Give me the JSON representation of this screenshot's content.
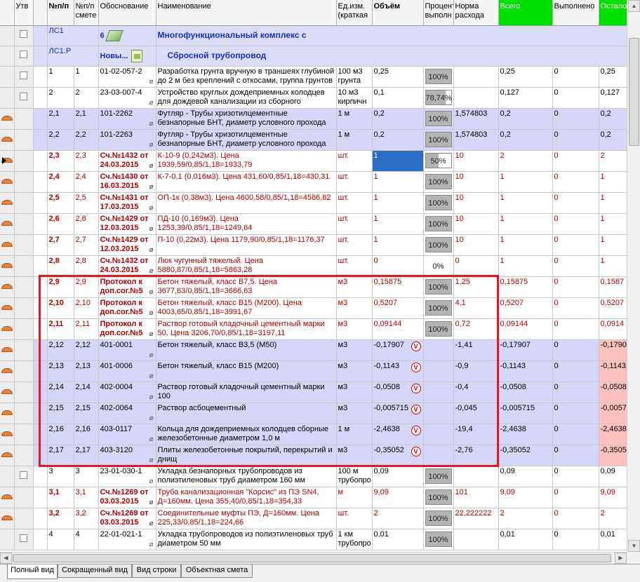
{
  "columns": {
    "utv": "Утв",
    "npp": "№п/п",
    "npp_smeta": "№п/п смете",
    "basis": "Обоснование",
    "name": "Наименование",
    "unit": "Ед.изм. (краткая",
    "volume": "Объём",
    "percent": "Процент выполн",
    "norm": "Норма расхода",
    "total": "Всего",
    "done": "Выполнено",
    "remain": "Остало"
  },
  "sections": [
    {
      "code": "ЛС1",
      "num": "6",
      "title": "Многофункциональный комплекс с"
    },
    {
      "code": "ЛС1.Р",
      "num": "Новы...",
      "title": "Сбросной трубопровод"
    }
  ],
  "rows": [
    {
      "npp": "1",
      "smeta": "1",
      "basis": "01-02-057-2",
      "name": "Разработка грунта вручную в траншеях глубиной до 2 м без креплений с откосами, группа грунтов",
      "unit": "100 м3 грунта",
      "volume": "0,25",
      "pct": "100%",
      "norm": "",
      "total": "0,25",
      "done": "0",
      "remain": "0,25"
    },
    {
      "npp": "2",
      "smeta": "2",
      "basis": "23-03-007-4",
      "name": "Устройство круглых дождеприемных колодцев для дождевой канализации из сборного",
      "unit": "10 м3 кирпичн",
      "volume": "0,1",
      "pct": "78,74%",
      "norm": "",
      "total": "0,127",
      "done": "0",
      "remain": "0,127"
    },
    {
      "npp": "2,1",
      "smeta": "2,1",
      "basis": "101-2262",
      "name": "Футляр - Трубы хризотилцементные безнапорные БНТ, диаметр условного прохода",
      "unit": "1 м",
      "volume": "0,2",
      "pct": "100%",
      "norm": "1,574803",
      "total": "0,2",
      "done": "0",
      "remain": "0,2"
    },
    {
      "npp": "2,2",
      "smeta": "2,2",
      "basis": "101-2263",
      "name": "Футляр - Трубы хризотилцементные безнапорные БНТ, диаметр условного прохода",
      "unit": "1 м",
      "volume": "0,2",
      "pct": "100%",
      "norm": "1,574803",
      "total": "0,2",
      "done": "0",
      "remain": "0,2"
    },
    {
      "npp": "2,3",
      "smeta": "2,3",
      "basis": "Сч.№1432 от 24.03.2015",
      "name": "К-10-9 (0,242м3). Цена 1939,59/0,85/1,18=1933,79",
      "unit": "шт.",
      "volume": "1",
      "pct": "50%",
      "norm": "10",
      "total": "2",
      "done": "0",
      "remain": "2"
    },
    {
      "npp": "2,4",
      "smeta": "2,4",
      "basis": "Сч.№1430 от 16.03.2015",
      "name": "К-7-0,1 (0,016м3). Цена 431,60/0,85/1,18=430,31",
      "unit": "шт.",
      "volume": "1",
      "pct": "100%",
      "norm": "10",
      "total": "1",
      "done": "0",
      "remain": "1"
    },
    {
      "npp": "2,5",
      "smeta": "2,5",
      "basis": "Сч.№1431 от 17.03.2015",
      "name": "ОП-1к (0,38м3). Цена 4600,58/0,85/1,18=4586,82",
      "unit": "шт.",
      "volume": "1",
      "pct": "100%",
      "norm": "10",
      "total": "1",
      "done": "0",
      "remain": "1"
    },
    {
      "npp": "2,6",
      "smeta": "2,6",
      "basis": "Сч.№1429 от 12.03.2015",
      "name": "ПД-10 (0,169м3). Цена 1253,39/0,85/1,18=1249,64",
      "unit": "шт.",
      "volume": "1",
      "pct": "100%",
      "norm": "10",
      "total": "1",
      "done": "0",
      "remain": "1"
    },
    {
      "npp": "2,7",
      "smeta": "2,7",
      "basis": "Сч.№1429 от 12.03.2015",
      "name": "П-10 (0,22м3). Цена 1179,90/0,85/1,18=1176,37",
      "unit": "шт.",
      "volume": "1",
      "pct": "100%",
      "norm": "10",
      "total": "1",
      "done": "0",
      "remain": "1"
    },
    {
      "npp": "2,8",
      "smeta": "2,8",
      "basis": "Сч.№1432 от 24.03.2015",
      "name": "Люк чугунный тяжелый. Цена 5880,87/0,85/1,18=5863,28",
      "unit": "шт.",
      "volume": "0",
      "pct": "0%",
      "norm": "0",
      "total": "1",
      "done": "0",
      "remain": "1"
    },
    {
      "npp": "2,9",
      "smeta": "2,9",
      "basis": "Протокол к доп.сог.№5",
      "name": "Бетон тяжелый, класс В7,5. Цена 3677,63/0,85/1,18=3666,63",
      "unit": "м3",
      "volume": "0,15875",
      "pct": "100%",
      "norm": "1,25",
      "total": "0,15875",
      "done": "0",
      "remain": "0,1587"
    },
    {
      "npp": "2,10",
      "smeta": "2,10",
      "basis": "Протокол к доп.сог.№5",
      "name": "Бетон тяжелый, класс В15 (М200). Цена 4003,65/0,85/1,18=3991,67",
      "unit": "м3",
      "volume": "0,5207",
      "pct": "100%",
      "norm": "4,1",
      "total": "0,5207",
      "done": "0",
      "remain": "0,5207"
    },
    {
      "npp": "2,11",
      "smeta": "2,11",
      "basis": "Протокол к доп.сог.№5",
      "name": "Раствор готовый кладочный цементный марки 50. Цена 3206,70/0,85/1,18=3197,11",
      "unit": "м3",
      "volume": "0,09144",
      "pct": "100%",
      "norm": "0,72",
      "total": "0,09144",
      "done": "0",
      "remain": "0,0914"
    },
    {
      "npp": "2,12",
      "smeta": "2,12",
      "basis": "401-0001",
      "name": "Бетон тяжелый, класс В3,5 (М50)",
      "unit": "м3",
      "volume": "-0,17907",
      "pct": "",
      "norm": "-1,41",
      "total": "-0,17907",
      "done": "0",
      "remain": "-0,1790"
    },
    {
      "npp": "2,13",
      "smeta": "2,13",
      "basis": "401-0006",
      "name": "Бетон тяжелый, класс В15 (М200)",
      "unit": "м3",
      "volume": "-0,1143",
      "pct": "",
      "norm": "-0,9",
      "total": "-0,1143",
      "done": "0",
      "remain": "-0,1143"
    },
    {
      "npp": "2,14",
      "smeta": "2,14",
      "basis": "402-0004",
      "name": "Раствор готовый кладочный цементный марки 100",
      "unit": "м3",
      "volume": "-0,0508",
      "pct": "",
      "norm": "-0,4",
      "total": "-0,0508",
      "done": "0",
      "remain": "-0,0508"
    },
    {
      "npp": "2,15",
      "smeta": "2,15",
      "basis": "402-0064",
      "name": "Раствор асбоцементный",
      "unit": "м3",
      "volume": "-0,005715",
      "pct": "",
      "norm": "-0,045",
      "total": "-0,005715",
      "done": "0",
      "remain": "-0,0057"
    },
    {
      "npp": "2,16",
      "smeta": "2,16",
      "basis": "403-0117",
      "name": "Кольца для дождеприемных колодцев сборные железобетонные диаметром 1,0 м",
      "unit": "1 м",
      "volume": "-2,4638",
      "pct": "",
      "norm": "-19,4",
      "total": "-2,4638",
      "done": "0",
      "remain": "-2,4638"
    },
    {
      "npp": "2,17",
      "smeta": "2,17",
      "basis": "403-3120",
      "name": "Плиты железобетонные покрытий, перекрытий и днищ",
      "unit": "м3",
      "volume": "-0,35052",
      "pct": "",
      "norm": "-2,76",
      "total": "-0,35052",
      "done": "0",
      "remain": "-0,3505"
    },
    {
      "npp": "3",
      "smeta": "3",
      "basis": "23-01-030-1",
      "name": "Укладка безнапорных трубопроводов из полиэтиленовых труб диаметром 160 мм",
      "unit": "100 м трубопро",
      "volume": "0,09",
      "pct": "100%",
      "norm": "",
      "total": "0,09",
      "done": "0",
      "remain": "0,09"
    },
    {
      "npp": "3,1",
      "smeta": "3,1",
      "basis": "Сч.№1269 от 03.03.2015",
      "name": "Труба канализационная \"Корсис\" из ПЭ SN4, Д=160мм. Цена 355,40/0,85/1,18=354,33",
      "unit": "м",
      "volume": "9,09",
      "pct": "100%",
      "norm": "101",
      "total": "9,09",
      "done": "0",
      "remain": "9,09"
    },
    {
      "npp": "3,2",
      "smeta": "3,2",
      "basis": "Сч.№1269 от 03.03.2015",
      "name": "Соединительные муфты ПЭ, Д=160мм. Цена 225,33/0,85/1,18=224,66",
      "unit": "шт.",
      "volume": "2",
      "pct": "100%",
      "norm": "22,222222",
      "total": "2",
      "done": "0",
      "remain": "2"
    },
    {
      "npp": "4",
      "smeta": "4",
      "basis": "22-01-021-1",
      "name": "Укладка трубопроводов из полиэтиленовых труб диаметром 50 мм",
      "unit": "1 км трубопро",
      "volume": "0,01",
      "pct": "100%",
      "norm": "",
      "total": "0,01",
      "done": "0",
      "remain": "0,01"
    }
  ],
  "row_styles": [
    "white",
    "white",
    "lav",
    "lav",
    "red",
    "red",
    "red",
    "red",
    "red",
    "red",
    "red",
    "red",
    "red",
    "lav",
    "lav",
    "lav",
    "lav",
    "lav",
    "lav",
    "white",
    "red",
    "red",
    "white"
  ],
  "tabs": [
    "Полный вид",
    "Сокращенный вид",
    "Вид строки",
    "Объектная смета"
  ],
  "colors": {
    "accent_green": "#00e000",
    "row_lavender": "#d6d6f8",
    "text_red": "#b00000",
    "highlight": "#e8141e",
    "negative_bg": "#ffc0c0"
  }
}
